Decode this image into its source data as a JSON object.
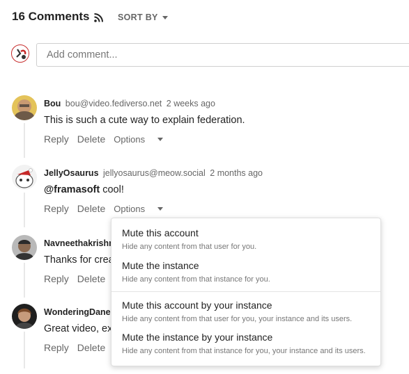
{
  "header": {
    "comments_count": "16 Comments",
    "sort_by_label": "SORT BY"
  },
  "composer": {
    "placeholder": "Add comment..."
  },
  "comments": [
    {
      "author": "Bou",
      "handle": "bou@video.fediverso.net",
      "date": "2 weeks ago",
      "text": "This is such a cute way to explain federation.",
      "mention": "",
      "reply_label": "Reply",
      "delete_label": "Delete",
      "options_label": "Options"
    },
    {
      "author": "JellyOsaurus",
      "handle": "jellyosaurus@meow.social",
      "date": "2 months ago",
      "mention": "@framasoft",
      "text": " cool!",
      "reply_label": "Reply",
      "delete_label": "Delete",
      "options_label": "Options"
    },
    {
      "author": "Navneethakrishn",
      "handle": "",
      "date": "",
      "text": "Thanks for crea",
      "mention": "",
      "reply_label": "Reply",
      "delete_label": "Delete",
      "options_label": ""
    },
    {
      "author": "WonderingDane",
      "handle": "",
      "date": "",
      "text": "Great video, exp",
      "mention": "",
      "reply_label": "Reply",
      "delete_label": "Delete",
      "options_label": ""
    }
  ],
  "options_menu": {
    "items": [
      {
        "title": "Mute this account",
        "description": "Hide any content from that user for you."
      },
      {
        "title": "Mute the instance",
        "description": "Hide any content from that instance for you."
      },
      {
        "title": "Mute this account by your instance",
        "description": "Hide any content from that user for you, your instance and its users."
      },
      {
        "title": "Mute the instance by your instance",
        "description": "Hide any content from that instance for you, your instance and its users."
      }
    ]
  },
  "icons": {
    "rss": "rss-icon",
    "caret": "chevron-down-icon"
  },
  "colors": {
    "text": "#222222",
    "muted": "#666666",
    "rss": "#222222"
  }
}
